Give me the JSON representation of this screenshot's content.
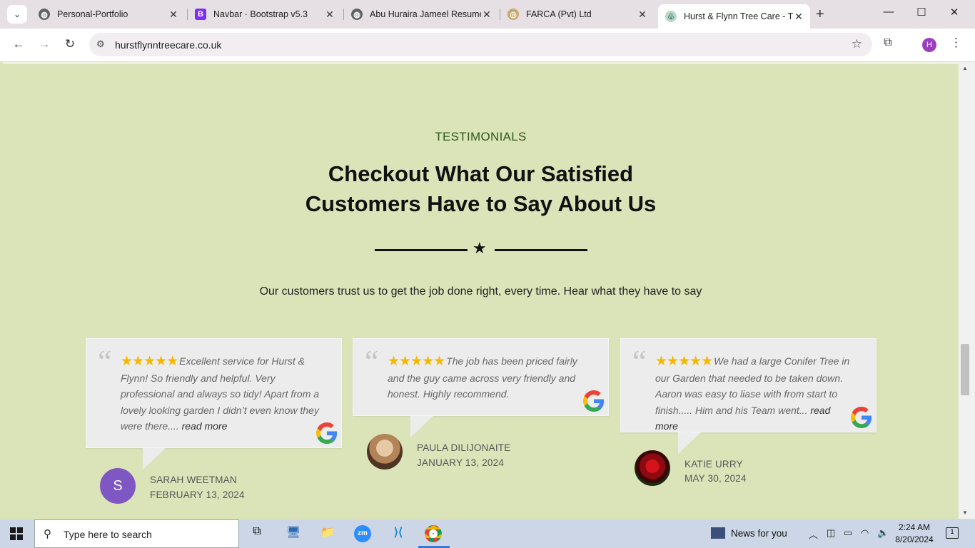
{
  "browser": {
    "tabs": [
      {
        "title": "Personal-Portfolio",
        "favicon": "globe-icon"
      },
      {
        "title": "Navbar · Bootstrap v5.3",
        "favicon": "bootstrap-icon"
      },
      {
        "title": "Abu Huraira Jameel Resume",
        "favicon": "globe-icon"
      },
      {
        "title": "FARCA (Pvt) Ltd",
        "favicon": "farca-icon"
      },
      {
        "title": "Hurst & Flynn Tree Care - Tr",
        "favicon": "tree-icon",
        "active": true
      }
    ],
    "url": "hurstflynntreecare.co.uk",
    "profile_initial": "H"
  },
  "section": {
    "eyebrow": "TESTIMONIALS",
    "heading_line1": "Checkout What Our Satisfied",
    "heading_line2": "Customers Have to Say About Us",
    "subtext": "Our customers trust us to get the job done right, every time. Hear what they have to say"
  },
  "testimonials": [
    {
      "stars": "★★★★★",
      "text": "Excellent service for Hurst & Flynn! So friendly and helpful. Very professional and always so tidy! Apart from a lovely looking garden I didn’t even know they were there....",
      "read_more": "read more",
      "name": "SARAH WEETMAN",
      "date": "FEBRUARY 13, 2024",
      "avatar_letter": "S"
    },
    {
      "stars": "★★★★★",
      "text": "The job has been priced fairly and the guy came across very friendly and honest. Highly recommend.",
      "read_more": "",
      "name": "PAULA DILIJONAITE",
      "date": "JANUARY 13, 2024"
    },
    {
      "stars": "★★★★★",
      "text": "We had a large Conifer Tree in our Garden that needed to be taken down. Aaron was easy to liase with from start to finish..... Him and his Team went...",
      "read_more": "read more",
      "name": "KATIE URRY",
      "date": "MAY 30, 2024"
    }
  ],
  "taskbar": {
    "search_placeholder": "Type here to search",
    "news": "News for you",
    "time": "2:24 AM",
    "date": "8/20/2024",
    "notification_count": "1"
  },
  "colors": {
    "page_bg": "#dbe3b9",
    "eyebrow": "#2d5a1d",
    "star": "#f5b800",
    "card_bg": "#ececec"
  }
}
